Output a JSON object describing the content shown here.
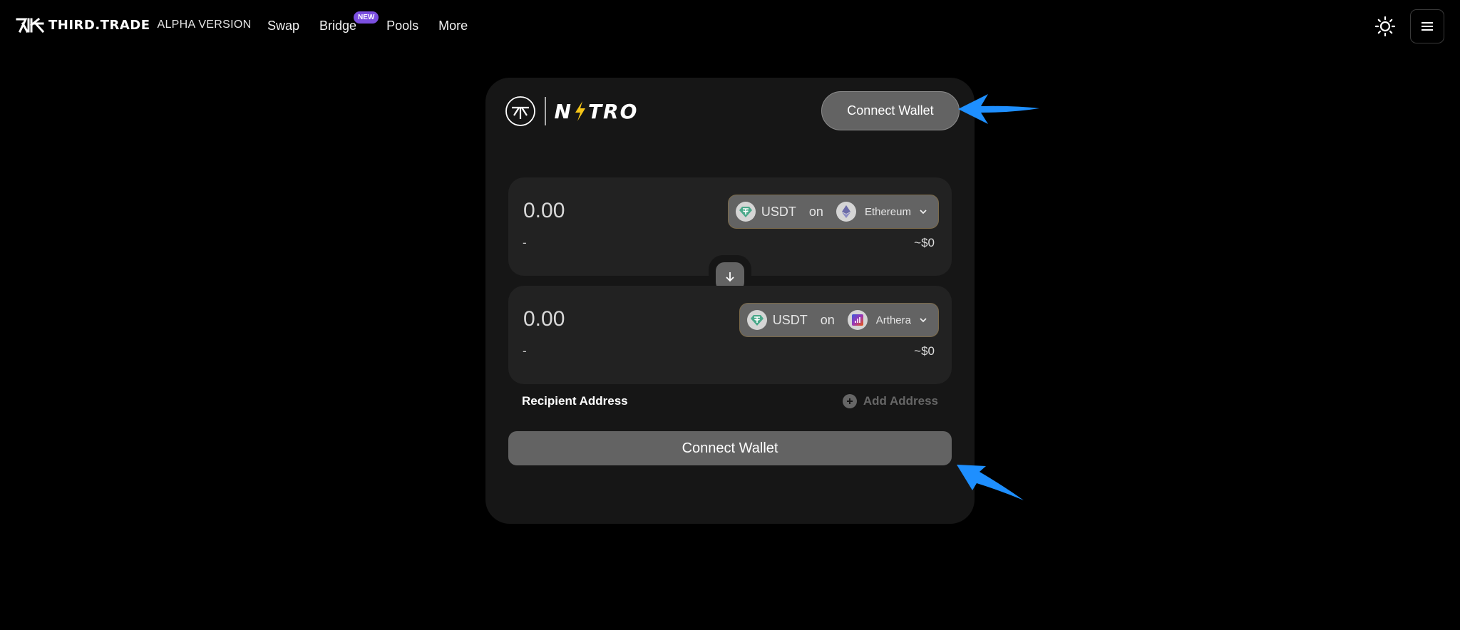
{
  "header": {
    "brand_name": "THIRD.TRADE",
    "brand_tag": "ALPHA VERSION",
    "nav": [
      {
        "label": "Swap"
      },
      {
        "label": "Bridge",
        "badge": "NEW"
      },
      {
        "label": "Pools"
      },
      {
        "label": "More"
      }
    ],
    "icons": {
      "theme": "sun-icon",
      "menu": "hamburger-menu-icon"
    }
  },
  "card": {
    "product_name": "NITRO",
    "header_connect_label": "Connect Wallet",
    "from": {
      "amount": "0.00",
      "sub_left": "-",
      "usd": "~$0",
      "token": "USDT",
      "on": "on",
      "chain": "Ethereum"
    },
    "to": {
      "amount": "0.00",
      "sub_left": "-",
      "usd": "~$0",
      "token": "USDT",
      "on": "on",
      "chain": "Arthera"
    },
    "recipient_label": "Recipient Address",
    "add_address_label": "Add Address",
    "main_connect_label": "Connect Wallet"
  },
  "colors": {
    "background": "#000000",
    "card": "#161616",
    "panel": "#222222",
    "button": "#636363",
    "badge": "#7b4fe0",
    "annotation_arrow": "#1e8fff",
    "nitro_bolt": "#f5c518"
  }
}
